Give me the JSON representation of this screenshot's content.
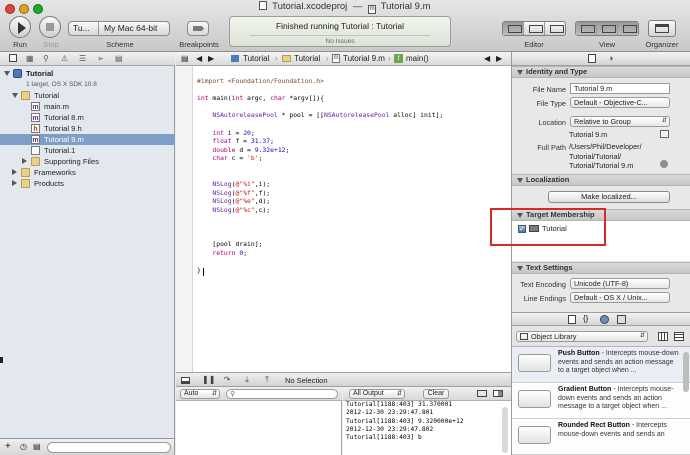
{
  "window": {
    "title_project": "Tutorial.xcodeproj",
    "title_file": "Tutorial 9.m",
    "title_separator": "—"
  },
  "toolbar": {
    "run_label": "Run",
    "stop_label": "Stop",
    "scheme_target": "Tu...",
    "scheme_destination": "My Mac 64-bit",
    "scheme_label": "Scheme",
    "breakpoints_label": "Breakpoints",
    "activity_status": "Finished running Tutorial : Tutorial",
    "activity_issues": "No Issues",
    "editor_label": "Editor",
    "view_label": "View",
    "organizer_label": "Organizer"
  },
  "navigator": {
    "project": {
      "name": "Tutorial",
      "subtitle": "1 target, OS X SDK 10.8"
    },
    "items": [
      {
        "label": "Tutorial",
        "kind": "folder",
        "indent": 1,
        "expanded": true
      },
      {
        "label": "main.m",
        "kind": "m",
        "indent": 2
      },
      {
        "label": "Tutorial 8.m",
        "kind": "m",
        "indent": 2
      },
      {
        "label": "Tutorial 9.h",
        "kind": "h",
        "indent": 2
      },
      {
        "label": "Tutorial 9.m",
        "kind": "m",
        "indent": 2,
        "selected": true
      },
      {
        "label": "Tutorial.1",
        "kind": "doc",
        "indent": 2
      },
      {
        "label": "Supporting Files",
        "kind": "folder",
        "indent": 2,
        "expanded": false
      },
      {
        "label": "Frameworks",
        "kind": "folder",
        "indent": 1,
        "expanded": false
      },
      {
        "label": "Products",
        "kind": "folder",
        "indent": 1,
        "expanded": false
      }
    ]
  },
  "jumpbar": {
    "crumb1": "Tutorial",
    "crumb2": "Tutorial",
    "crumb3": "Tutorial 9.m",
    "crumb4": "main()"
  },
  "editor": {
    "lines": [
      "#import <Foundation/Foundation.h>",
      "",
      "int main(int argc, char *argv[]){",
      "",
      "    NSAutoreleasePool * pool = [[NSAutoreleasePool alloc] init];",
      "",
      "    int i = 20;",
      "    float f = 31.37;",
      "    double d = 9.32e+12;",
      "    char c = 'b';",
      "",
      "",
      "    NSLog(@\"%i\",i);",
      "    NSLog(@\"%f\",f);",
      "    NSLog(@\"%e\",d);",
      "    NSLog(@\"%c\",c);",
      "",
      "",
      "",
      "    [pool drain];",
      "    return 0;",
      "",
      "}"
    ]
  },
  "debug": {
    "selection_label": "No Selection",
    "vars_popup": "Auto",
    "output_popup": "All Output",
    "clear_label": "Clear",
    "console_lines": [
      "Tutorial[1188:403] 31.370001",
      "2012-12-30 23:29:47.801",
      "Tutorial[1188:403] 9.320000e+12",
      "2012-12-30 23:29:47.802",
      "Tutorial[1188:403] b"
    ]
  },
  "inspector": {
    "identity": {
      "header": "Identity and Type",
      "file_name_label": "File Name",
      "file_name": "Tutorial 9.m",
      "file_type_label": "File Type",
      "file_type": "Default - Objective-C...",
      "location_label": "Location",
      "location": "Relative to Group",
      "location_file": "Tutorial 9.m",
      "full_path_label": "Full Path",
      "full_path_1": "/Users/Phil/Developer/",
      "full_path_2": "Tutorial/Tutorial/",
      "full_path_3": "Tutorial/Tutorial 9.m"
    },
    "localization": {
      "header": "Localization",
      "button": "Make localized..."
    },
    "membership": {
      "header": "Target Membership",
      "target": "Tutorial",
      "checked": true
    },
    "text_settings": {
      "header": "Text Settings",
      "encoding_label": "Text Encoding",
      "encoding": "Unicode (UTF-8)",
      "endings_label": "Line Endings",
      "endings": "Default - OS X / Unix..."
    },
    "library": {
      "popup": "Object Library",
      "items": [
        {
          "title": "Push Button",
          "desc": " - Intercepts mouse-down events and sends an action message to a target object when ..."
        },
        {
          "title": "Gradient Button",
          "desc": " - Intercepts mouse-down events and sends an action message to a target object when ..."
        },
        {
          "title": "Rounded Rect Button",
          "desc": " - Intercepts mouse-down events and sends an"
        }
      ]
    }
  },
  "colors": {
    "selection": "#7f9ec7",
    "highlight_box": "#d42a2a",
    "keyword": "#a5007a",
    "string": "#c41a16"
  }
}
